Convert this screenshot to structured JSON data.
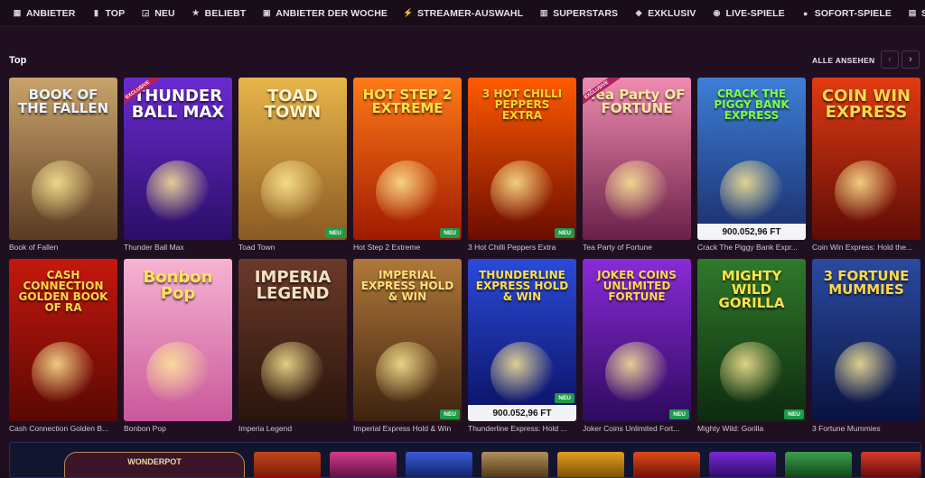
{
  "nav": {
    "items": [
      {
        "icon": "grid-icon",
        "glyph": "▦",
        "label": "ANBIETER"
      },
      {
        "icon": "bar-chart-icon",
        "glyph": "▮",
        "label": "TOP"
      },
      {
        "icon": "new-box-icon",
        "glyph": "◲",
        "label": "NEU"
      },
      {
        "icon": "star-icon",
        "glyph": "★",
        "label": "BELIEBT"
      },
      {
        "icon": "card-icon",
        "glyph": "▣",
        "label": "ANBIETER DER WOCHE"
      },
      {
        "icon": "bolt-icon",
        "glyph": "⚡",
        "label": "STREAMER-AUSWAHL"
      },
      {
        "icon": "slot-icon",
        "glyph": "▥",
        "label": "SUPERSTARS"
      },
      {
        "icon": "diamond-icon",
        "glyph": "◆",
        "label": "EXKLUSIV"
      },
      {
        "icon": "live-icon",
        "glyph": "◉",
        "label": "LIVE-SPIELE"
      },
      {
        "icon": "person-icon",
        "glyph": "●",
        "label": "SOFORT-SPIELE"
      },
      {
        "icon": "slot-machine-icon",
        "glyph": "▤",
        "label": "SLOTS"
      }
    ]
  },
  "section": {
    "title": "Top",
    "see_all": "ALLE ANSEHEN",
    "prev": "‹",
    "next": "›"
  },
  "badges": {
    "new": "NEU",
    "exclusive": "EXCLUSIVE"
  },
  "games": [
    {
      "name": "Book of Fallen",
      "art_title": "BOOK OF THE FALLEN",
      "bg": [
        "#c9a36b",
        "#5b3a22"
      ],
      "fg": "#e9f2ff",
      "isNew": false,
      "exclusive": false,
      "jackpot": ""
    },
    {
      "name": "Thunder Ball Max",
      "art_title": "THUNDER BALL MAX",
      "bg": [
        "#6a2bd1",
        "#2a0e66"
      ],
      "fg": "#ffffff",
      "isNew": false,
      "exclusive": true,
      "jackpot": ""
    },
    {
      "name": "Toad Town",
      "art_title": "TOAD TOWN",
      "bg": [
        "#e8b54a",
        "#8a5a23"
      ],
      "fg": "#fff3c4",
      "isNew": true,
      "exclusive": false,
      "jackpot": ""
    },
    {
      "name": "Hot Step 2 Extreme",
      "art_title": "HOT STEP 2 EXTREME",
      "bg": [
        "#ff7a18",
        "#a01a00"
      ],
      "fg": "#ffe14a",
      "isNew": true,
      "exclusive": false,
      "jackpot": ""
    },
    {
      "name": "3 Hot Chilli Peppers Extra",
      "art_title": "3 HOT CHILLI PEPPERS EXTRA",
      "bg": [
        "#ff5a00",
        "#6b0c00"
      ],
      "fg": "#ffd32a",
      "isNew": true,
      "exclusive": false,
      "jackpot": ""
    },
    {
      "name": "Tea Party of Fortune",
      "art_title": "Tea Party OF FORTUNE",
      "bg": [
        "#f08bb0",
        "#6a2048"
      ],
      "fg": "#ffe8a0",
      "isNew": false,
      "exclusive": true,
      "jackpot": ""
    },
    {
      "name": "Crack The Piggy Bank Expr...",
      "art_title": "CRACK THE PIGGY BANK EXPRESS",
      "bg": [
        "#3d7fd6",
        "#1a2d6a"
      ],
      "fg": "#7cff43",
      "isNew": false,
      "exclusive": false,
      "jackpot": "900.052,96 FT"
    },
    {
      "name": "Coin Win Express: Hold the...",
      "art_title": "COIN WIN EXPRESS",
      "bg": [
        "#e23a12",
        "#5e0c06"
      ],
      "fg": "#ffd84a",
      "isNew": false,
      "exclusive": false,
      "jackpot": ""
    },
    {
      "name": "Cash Connection Golden B...",
      "art_title": "CASH CONNECTION GOLDEN BOOK OF RA",
      "bg": [
        "#c4180c",
        "#5a0804"
      ],
      "fg": "#ffd84a",
      "isNew": false,
      "exclusive": false,
      "jackpot": ""
    },
    {
      "name": "Bonbon Pop",
      "art_title": "Bonbon Pop",
      "bg": [
        "#f7b3d2",
        "#c9589a"
      ],
      "fg": "#ffe45a",
      "isNew": false,
      "exclusive": false,
      "jackpot": ""
    },
    {
      "name": "Imperia Legend",
      "art_title": "IMPERIA LEGEND",
      "bg": [
        "#6a3a2a",
        "#2a140c"
      ],
      "fg": "#f3e2c4",
      "isNew": false,
      "exclusive": false,
      "jackpot": ""
    },
    {
      "name": "Imperial Express Hold & Win",
      "art_title": "IMPERIAL EXPRESS HOLD & WIN",
      "bg": [
        "#b0783a",
        "#3d220e"
      ],
      "fg": "#ffdf7a",
      "isNew": true,
      "exclusive": false,
      "jackpot": ""
    },
    {
      "name": "Thunderline Express: Hold ...",
      "art_title": "THUNDERLINE EXPRESS HOLD & WIN",
      "bg": [
        "#2a4ad8",
        "#0a1060"
      ],
      "fg": "#ffdf4a",
      "isNew": true,
      "exclusive": false,
      "jackpot": "900.052,96 FT"
    },
    {
      "name": "Joker Coins Unlimited Fort...",
      "art_title": "JOKER COINS UNLIMITED FORTUNE",
      "bg": [
        "#8a2ad8",
        "#2e0a5e"
      ],
      "fg": "#ffd84a",
      "isNew": true,
      "exclusive": false,
      "jackpot": ""
    },
    {
      "name": "Mighty Wild: Gorilla",
      "art_title": "MIGHTY WILD GORILLA",
      "bg": [
        "#2f7a2a",
        "#0e2a10"
      ],
      "fg": "#ffe14a",
      "isNew": true,
      "exclusive": false,
      "jackpot": ""
    },
    {
      "name": "3 Fortune Mummies",
      "art_title": "3 FORTUNE MUMMIES",
      "bg": [
        "#2a4aa0",
        "#0a1240"
      ],
      "fg": "#ffd84a",
      "isNew": false,
      "exclusive": false,
      "jackpot": ""
    }
  ],
  "bottom": {
    "promo_title": "WONDERPOT"
  }
}
